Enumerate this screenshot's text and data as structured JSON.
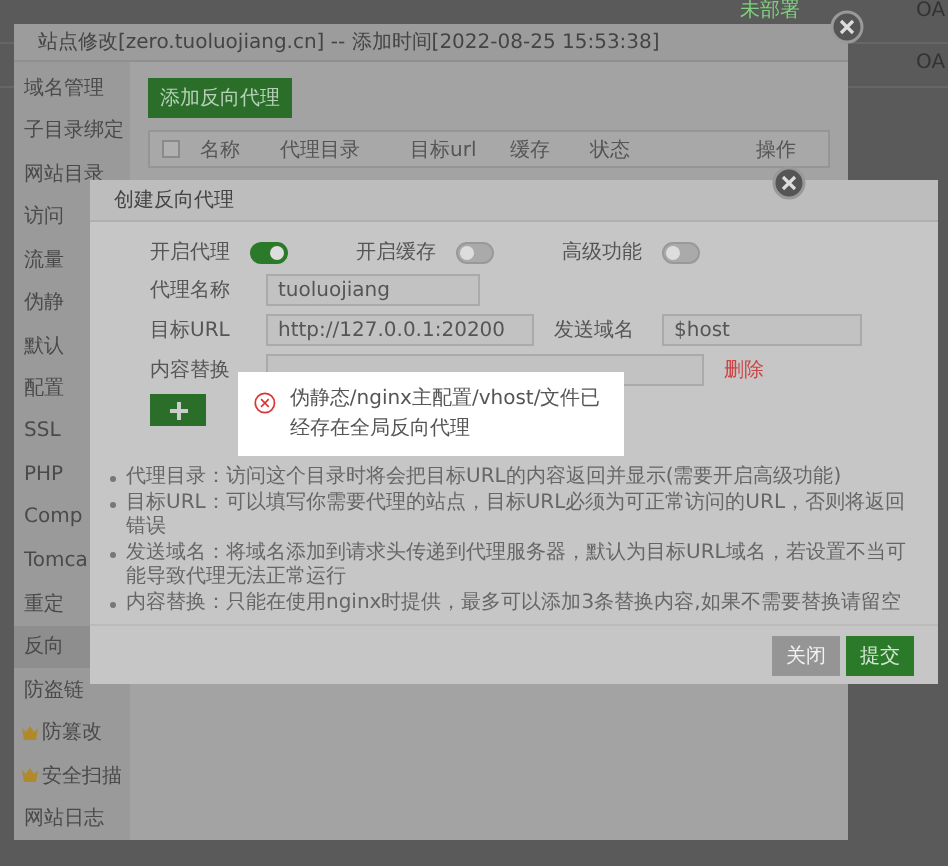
{
  "background": {
    "rows": [
      {
        "status": "未部署",
        "column_3": "OA"
      },
      {
        "column_3": "OA"
      }
    ]
  },
  "site_dialog": {
    "title": "站点修改[zero.tuoluojiang.cn] -- 添加时间[2022-08-25 15:53:38]",
    "sidebar": {
      "items": [
        {
          "label": "域名管理",
          "selected": false,
          "kind": "plain"
        },
        {
          "label": "子目录绑定",
          "selected": false,
          "kind": "plain"
        },
        {
          "label": "网站目录",
          "selected": false,
          "kind": "plain"
        },
        {
          "label": "访问",
          "selected": false,
          "kind": "plain"
        },
        {
          "label": "流量",
          "selected": false,
          "kind": "plain"
        },
        {
          "label": "伪静",
          "selected": false,
          "kind": "plain"
        },
        {
          "label": "默认",
          "selected": false,
          "kind": "plain"
        },
        {
          "label": "配置",
          "selected": false,
          "kind": "plain"
        },
        {
          "label": "SSL",
          "selected": false,
          "kind": "plain"
        },
        {
          "label": "PHP",
          "selected": false,
          "kind": "plain"
        },
        {
          "label": "Comp",
          "selected": false,
          "kind": "plain"
        },
        {
          "label": "Tomca",
          "selected": false,
          "kind": "plain"
        },
        {
          "label": "重定",
          "selected": false,
          "kind": "plain"
        },
        {
          "label": "反向",
          "selected": true,
          "kind": "plain"
        },
        {
          "label": "防盗链",
          "selected": false,
          "kind": "plain"
        },
        {
          "label": "防篡改",
          "selected": false,
          "kind": "pro"
        },
        {
          "label": "安全扫描",
          "selected": false,
          "kind": "pro"
        },
        {
          "label": "网站日志",
          "selected": false,
          "kind": "plain"
        }
      ]
    },
    "add_button": "添加反向代理",
    "table": {
      "select_all_checked": false,
      "columns": [
        "名称",
        "代理目录",
        "目标url",
        "缓存",
        "状态",
        "操作"
      ]
    }
  },
  "proxy_dialog": {
    "title": "创建反向代理",
    "toggles": [
      {
        "label": "开启代理",
        "on": true
      },
      {
        "label": "开启缓存",
        "on": false
      },
      {
        "label": "高级功能",
        "on": false
      }
    ],
    "name_field": {
      "label": "代理名称",
      "value": "tuoluojiang"
    },
    "target_field": {
      "label": "目标URL",
      "value": "http://127.0.0.1:20200"
    },
    "host_field": {
      "label": "发送域名",
      "value": "$host"
    },
    "replace": {
      "label": "内容替换",
      "delete": "删除"
    },
    "hints": [
      "代理目录：访问这个目录时将会把目标URL的内容返回并显示(需要开启高级功能)",
      "目标URL：可以填写你需要代理的站点，目标URL必须为可正常访问的URL，否则将返回错误",
      "发送域名：将域名添加到请求头传递到代理服务器，默认为目标URL域名，若设置不当可能导致代理无法正常运行",
      "内容替换：只能在使用nginx时提供，最多可以添加3条替换内容,如果不需要替换请留空"
    ],
    "buttons": [
      {
        "label": "关闭",
        "kind": "secondary"
      },
      {
        "label": "提交",
        "kind": "primary"
      }
    ]
  },
  "toast": {
    "kind": "error",
    "message": "伪静态/nginx主配置/vhost/文件已经存在全局反向代理"
  }
}
